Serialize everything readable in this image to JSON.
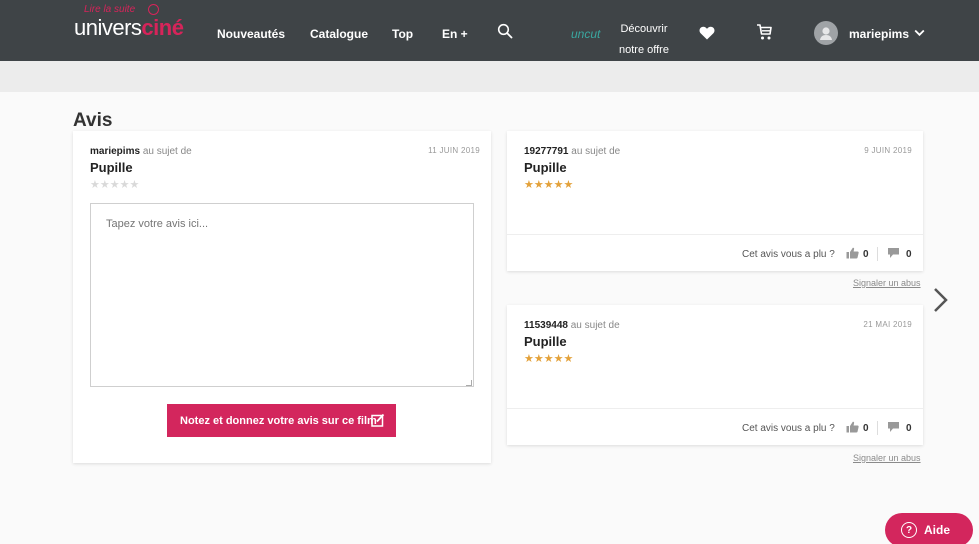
{
  "header": {
    "logo_tag": "Lire la suite",
    "logo_prefix": "univers",
    "logo_accent": "ciné",
    "nav": [
      "Nouveautés",
      "Catalogue",
      "Top",
      "En +"
    ],
    "uncut_label": "uncut",
    "discover_line1": "Découvrir",
    "discover_line2": "notre offre",
    "username": "mariepims"
  },
  "page": {
    "title": "Avis"
  },
  "write_review": {
    "author": "mariepims",
    "about": "au sujet de",
    "film": "Pupille",
    "date": "11 JUIN 2019",
    "stars": "★★★★★",
    "rating": 0,
    "placeholder": "Tapez votre avis ici...",
    "submit_label": "Notez et donnez votre avis sur ce film"
  },
  "reviews": [
    {
      "author": "19277791",
      "about": "au sujet de",
      "film": "Pupille",
      "date": "9 JUIN 2019",
      "stars": "★★★★★",
      "rating": 5,
      "helpful_label": "Cet avis vous a plu ?",
      "likes": "0",
      "comments": "0",
      "report_label": "Signaler un abus"
    },
    {
      "author": "11539448",
      "about": "au sujet de",
      "film": "Pupille",
      "date": "21 MAI 2019",
      "stars": "★★★★★",
      "rating": 5,
      "helpful_label": "Cet avis vous a plu ?",
      "likes": "0",
      "comments": "0",
      "report_label": "Signaler un abus"
    }
  ],
  "help": {
    "icon": "?",
    "label": "Aide"
  },
  "colors": {
    "brand": "#d3265d",
    "topbar": "#3f4447",
    "star": "#e3a13a",
    "uncut": "#3aa7a0"
  }
}
